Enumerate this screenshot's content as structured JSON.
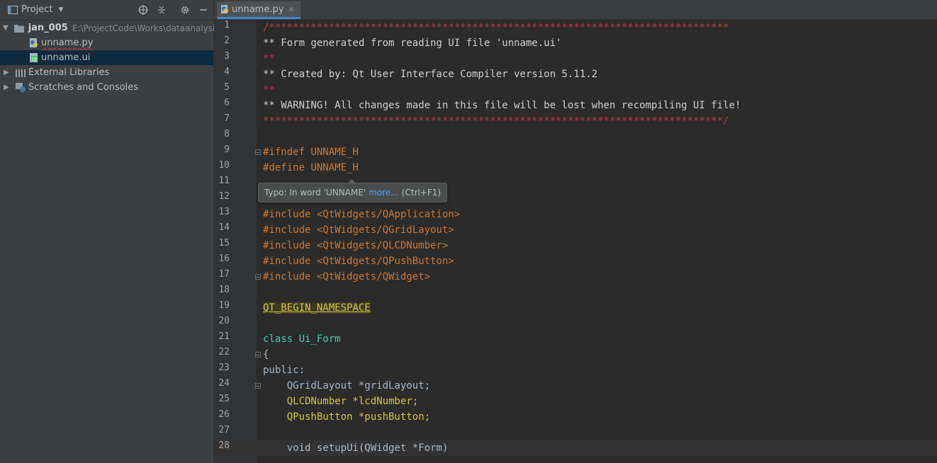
{
  "panel": {
    "title": "Project",
    "tree": [
      {
        "label": "jan_005",
        "path": "E:\\ProjectCode\\Works\\dataanalysis\\",
        "expanded": true
      },
      {
        "label": "unname.py"
      },
      {
        "label": "unname.ui"
      },
      {
        "label": "External Libraries"
      },
      {
        "label": "Scratches and Consoles"
      }
    ]
  },
  "editor": {
    "tab": "unname.py",
    "tooltip": {
      "text": "Typo: In word 'UNNAME'",
      "link": "more...",
      "shortcut": "(Ctrl+F1)"
    },
    "lines": [
      {
        "n": "1",
        "text": "/*****************************************************************************"
      },
      {
        "n": "2",
        "text": "** Form generated from reading UI file 'unname.ui'"
      },
      {
        "n": "3",
        "text": "**"
      },
      {
        "n": "4",
        "text": "** Created by: Qt User Interface Compiler version 5.11.2"
      },
      {
        "n": "5",
        "text": "**"
      },
      {
        "n": "6",
        "text": "** WARNING! All changes made in this file will be lost when recompiling UI file!"
      },
      {
        "n": "7",
        "text": "*****************************************************************************/"
      },
      {
        "n": "8",
        "text": ""
      },
      {
        "n": "9",
        "text": "#ifndef UNNAME_H"
      },
      {
        "n": "10",
        "text": "#define UNNAME_H"
      },
      {
        "n": "11",
        "text": ""
      },
      {
        "n": "12",
        "text": ""
      },
      {
        "n": "13",
        "text": "#include <QtWidgets/QApplication>"
      },
      {
        "n": "14",
        "text": "#include <QtWidgets/QGridLayout>"
      },
      {
        "n": "15",
        "text": "#include <QtWidgets/QLCDNumber>"
      },
      {
        "n": "16",
        "text": "#include <QtWidgets/QPushButton>"
      },
      {
        "n": "17",
        "text": "#include <QtWidgets/QWidget>"
      },
      {
        "n": "18",
        "text": ""
      },
      {
        "n": "19",
        "text": "QT_BEGIN_NAMESPACE"
      },
      {
        "n": "20",
        "text": ""
      },
      {
        "n": "21",
        "text": "class Ui_Form"
      },
      {
        "n": "22",
        "text": "{"
      },
      {
        "n": "23",
        "text": "public:"
      },
      {
        "n": "24",
        "text": "    QGridLayout *gridLayout;"
      },
      {
        "n": "25",
        "text": "    QLCDNumber *lcdNumber;"
      },
      {
        "n": "26",
        "text": "    QPushButton *pushButton;"
      },
      {
        "n": "27",
        "text": ""
      },
      {
        "n": "28",
        "text": "    void setupUi(QWidget *Form)"
      }
    ]
  }
}
